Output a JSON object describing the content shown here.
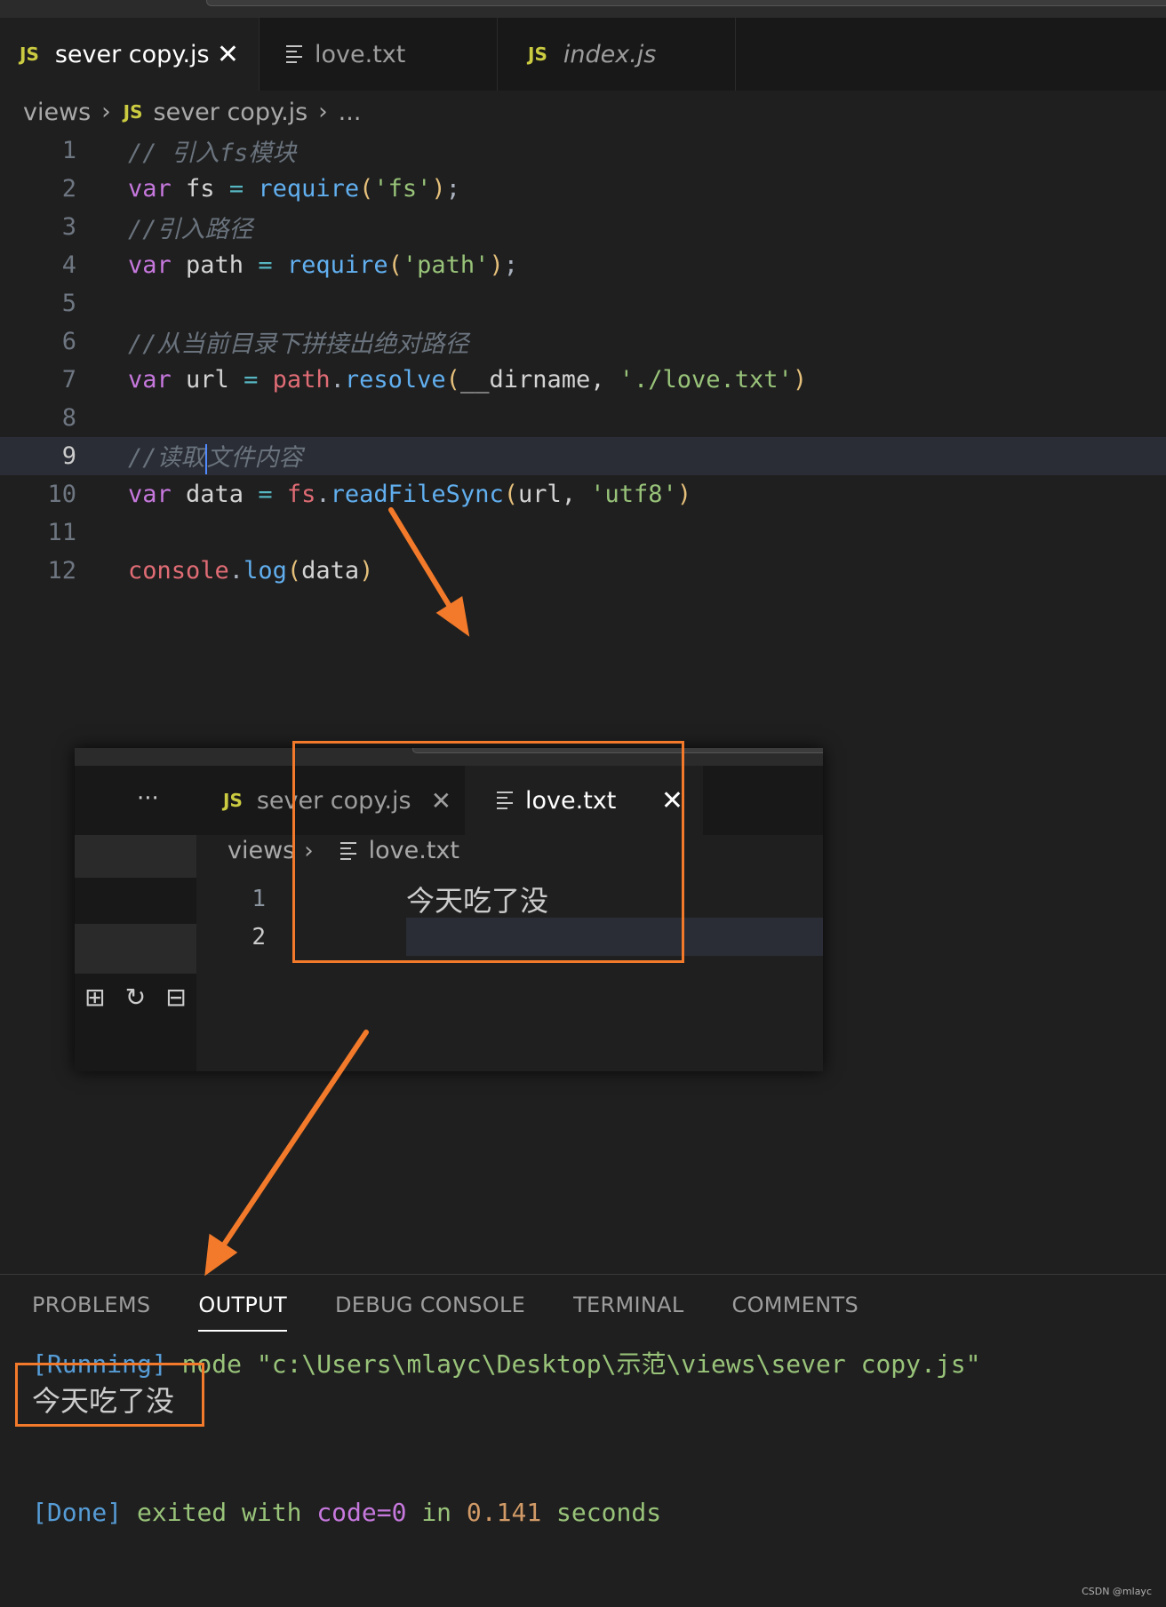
{
  "editor": {
    "tabs": [
      {
        "label": "sever copy.js",
        "icon": "js-icon",
        "active": true
      },
      {
        "label": "love.txt",
        "icon": "text-file-icon",
        "active": false
      },
      {
        "label": "index.js",
        "icon": "js-icon",
        "active": false
      }
    ],
    "close_glyph": "✕",
    "js_badge": "JS",
    "breadcrumb": {
      "folder": "views",
      "file": "sever copy.js",
      "more": "..."
    },
    "line_numbers": [
      "1",
      "2",
      "3",
      "4",
      "5",
      "6",
      "7",
      "8",
      "9",
      "10",
      "11",
      "12"
    ],
    "current_line": "9",
    "code": {
      "l1": "// 引入fs模块",
      "l2": {
        "kw": "var",
        "name": " fs ",
        "op": "=",
        "fn": " require",
        "p1": "(",
        "str": "'fs'",
        "p2": ")",
        "end": ";"
      },
      "l3": "//引入路径",
      "l4": {
        "kw": "var",
        "name": " path ",
        "op": "=",
        "fn": " require",
        "p1": "(",
        "str": "'path'",
        "p2": ")",
        "end": ";"
      },
      "l6": "//从当前目录下拼接出绝对路径",
      "l7": {
        "kw": "var",
        "name": " url ",
        "op": "=",
        "obj": " path",
        "dot": ".",
        "fn": "resolve",
        "p1": "(",
        "arg": "__dirname, ",
        "str": "'./love.txt'",
        "p2": ")"
      },
      "l9a": "//读取",
      "l9b": "文件内容",
      "l10": {
        "kw": "var",
        "name": " data ",
        "op": "=",
        "obj": " fs",
        "dot": ".",
        "fn": "readFileSync",
        "p1": "(",
        "arg": "url, ",
        "str": "'utf8'",
        "p2": ")"
      },
      "l12": {
        "obj": "console",
        "dot": ".",
        "fn": "log",
        "p1": "(",
        "arg": "data",
        "p2": ")"
      }
    }
  },
  "inset": {
    "more_glyph": "···",
    "tabs": [
      {
        "label": "sever copy.js",
        "active": false
      },
      {
        "label": "love.txt",
        "active": true
      }
    ],
    "breadcrumb": {
      "folder": "views",
      "file": "love.txt"
    },
    "lines": [
      {
        "num": "1",
        "text": "今天吃了没"
      },
      {
        "num": "2",
        "text": ""
      }
    ],
    "icons": [
      "new-file-icon",
      "refresh-icon",
      "collapse-icon"
    ]
  },
  "panel": {
    "tabs": [
      "PROBLEMS",
      "OUTPUT",
      "DEBUG CONSOLE",
      "TERMINAL",
      "COMMENTS"
    ],
    "active_tab": "OUTPUT",
    "running_tag": "[Running]",
    "running_cmd": " node \"c:\\Users\\mlayc\\Desktop\\示范\\views\\sever copy.js\"",
    "output_text": "今天吃了没",
    "done_tag": "[Done]",
    "done_msg_a": " exited with ",
    "done_code": "code=0",
    "done_msg_b": " in ",
    "done_time": "0.141",
    "done_msg_c": " seconds"
  },
  "watermark": "CSDN @mlayc",
  "colors": {
    "annotation": "#f27a2a",
    "background": "#1f1f1f",
    "tabbar": "#181818"
  }
}
